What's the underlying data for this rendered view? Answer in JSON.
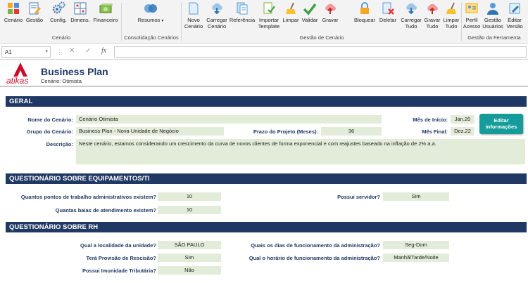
{
  "ribbon": {
    "buttons": [
      {
        "id": "cenario",
        "label": "Cenário",
        "icon": "scenario-puzzle-icon"
      },
      {
        "id": "gestao",
        "label": "Gestão",
        "icon": "clipboard-edit-icon"
      },
      {
        "id": "config",
        "label": "Config.",
        "icon": "gears-icon"
      },
      {
        "id": "dimens",
        "label": "Dimens.",
        "icon": "dimensions-grid-icon"
      },
      {
        "id": "financeiro",
        "label": "Financeiro",
        "icon": "money-icon"
      },
      {
        "id": "resumos",
        "label": "Resumos",
        "icon": "summary-circles-icon"
      },
      {
        "id": "novo",
        "label": "Novo Cenário",
        "icon": "new-file-icon"
      },
      {
        "id": "carregar",
        "label": "Carregar Cenário",
        "icon": "cloud-download-icon"
      },
      {
        "id": "referencia",
        "label": "Referência",
        "icon": "reference-doc-icon"
      },
      {
        "id": "importar",
        "label": "Importar Template",
        "icon": "import-template-icon"
      },
      {
        "id": "limpar",
        "label": "Limpar",
        "icon": "broom-icon"
      },
      {
        "id": "validar",
        "label": "Validar",
        "icon": "checkmark-icon"
      },
      {
        "id": "gravar",
        "label": "Gravar",
        "icon": "cloud-upload-icon"
      },
      {
        "id": "bloquear",
        "label": "Bloquear",
        "icon": "lock-icon"
      },
      {
        "id": "deletar",
        "label": "Deletar",
        "icon": "delete-x-icon"
      },
      {
        "id": "carregar_tudo",
        "label": "Carregar Tudo",
        "icon": "cloud-download-icon"
      },
      {
        "id": "gravar_tudo",
        "label": "Gravar Tudo",
        "icon": "cloud-upload-icon"
      },
      {
        "id": "limpar_tudo",
        "label": "Limpar Tudo",
        "icon": "broom-icon"
      },
      {
        "id": "perfil",
        "label": "Perfil Acesso",
        "icon": "access-profile-icon"
      },
      {
        "id": "gestao_usuarios",
        "label": "Gestão Usuários",
        "icon": "users-icon"
      },
      {
        "id": "editar_versao",
        "label": "Editar Versão",
        "icon": "edit-version-icon"
      }
    ],
    "groups": {
      "cenario": "Cenário",
      "consolidacao": "Consolidação Cenários",
      "gestao_cenario": "Gestão de Cenário",
      "gestao_ferramenta": "Gestão da Ferramenta"
    }
  },
  "formula_bar": {
    "cell_ref": "A1",
    "cancel": "✕",
    "enter": "✓",
    "fx": "fx",
    "content": ""
  },
  "header": {
    "logo_text": "atikas",
    "title": "Business Plan",
    "subtitle": "Cenário: Otimista"
  },
  "geral": {
    "title": "GERAL",
    "nome_label": "Nome do Cenário:",
    "nome_value": "Cenário Otimista",
    "grupo_label": "Grupo do Cenário:",
    "grupo_value": "Business Plan - Nova Unidade de Negócio",
    "prazo_label": "Prazo do Projeto (Meses):",
    "prazo_value": "36",
    "mes_inicio_label": "Mês de Início:",
    "mes_inicio_value": "Jan.20",
    "mes_final_label": "Mês Final:",
    "mes_final_value": "Dez.22",
    "descricao_label": "Descrição:",
    "descricao_value": "Neste cenário, estamos considerando um crescimento da curva de novos clientes de forma exponencial e com reajustes baseado na inflação de 2% a.a.",
    "edit_button": "Editar informações"
  },
  "equipamentos": {
    "title": "QUESTIONÁRIO SOBRE EQUIPAMENTOS/TI",
    "q1_label": "Quantos pontos de trabalho administrativos existem?",
    "q1_value": "10",
    "q2_label": "Quantas baias de atendimento existem?",
    "q2_value": "10",
    "q3_label": "Possui servidor?",
    "q3_value": "Sim"
  },
  "rh": {
    "title": "QUESTIONÁRIO SOBRE RH",
    "q1_label": "Qual a localidade da unidade?",
    "q1_value": "SÃO PAULO",
    "q2_label": "Terá Provisão de Rescisão?",
    "q2_value": "Sim",
    "q3_label": "Possui Imunidade Tributária?",
    "q3_value": "Não",
    "q4_label": "Quais os dias de funcionamento da administração?",
    "q4_value": "Seg-Dom",
    "q5_label": "Qual o horário de funcionamento da administração?",
    "q5_value": "Manhã/Tarde/Noite"
  },
  "colors": {
    "navy": "#1f3864",
    "input_green": "#e2ecd9",
    "button_teal": "#169b9b",
    "brand_red": "#c8102e"
  }
}
